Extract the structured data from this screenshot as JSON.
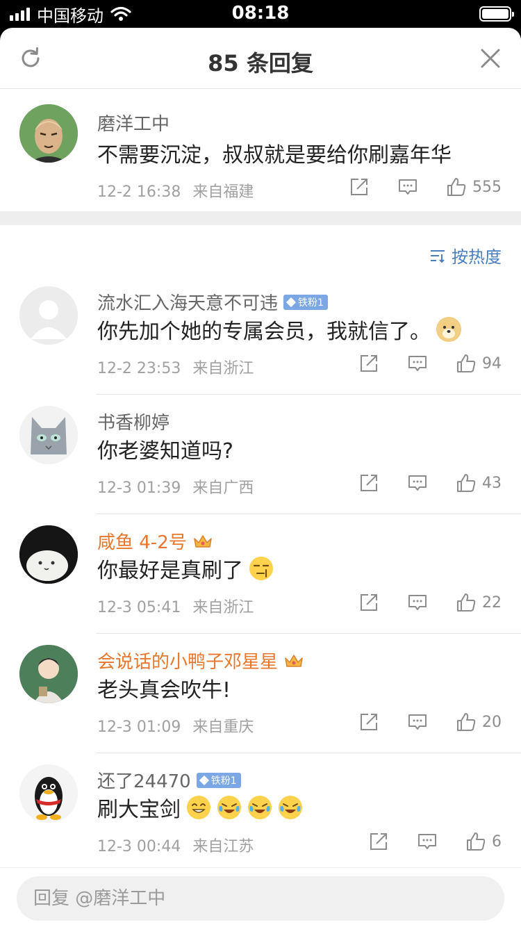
{
  "status_bar": {
    "carrier": "中国移动",
    "time": "08:18"
  },
  "header": {
    "title": "85 条回复"
  },
  "main_comment": {
    "author": "磨洋工中",
    "text": "不需要沉淀，叔叔就是要给你刷嘉年华",
    "time": "12-2 16:38",
    "location": "来自福建",
    "likes": "555"
  },
  "sort": {
    "label": "按热度"
  },
  "replies": [
    {
      "author": "流水汇入海天意不可违",
      "badge": "铁粉1",
      "text": "你先加个她的专属会员，我就信了。",
      "time": "12-2 23:53",
      "location": "来自浙江",
      "likes": "94"
    },
    {
      "author": "书香柳婷",
      "text": "你老婆知道吗?",
      "time": "12-3 01:39",
      "location": "来自广西",
      "likes": "43"
    },
    {
      "author": "咸鱼 4-2号",
      "text": "你最好是真刷了",
      "time": "12-3 05:41",
      "location": "来自浙江",
      "likes": "22"
    },
    {
      "author": "会说话的小鸭子邓星星",
      "text": "老头真会吹牛!",
      "time": "12-3 01:09",
      "location": "来自重庆",
      "likes": "20"
    },
    {
      "author": "还了24470",
      "badge": "铁粉1",
      "text": "刷大宝剑",
      "time": "12-3 00:44",
      "location": "来自江苏",
      "likes": "6"
    }
  ],
  "reply_input": {
    "placeholder": "回复 @磨洋工中"
  },
  "colors": {
    "accent_blue": "#4a7fbf",
    "vip_orange": "#e8772e",
    "badge_blue": "#7ba7e4"
  }
}
